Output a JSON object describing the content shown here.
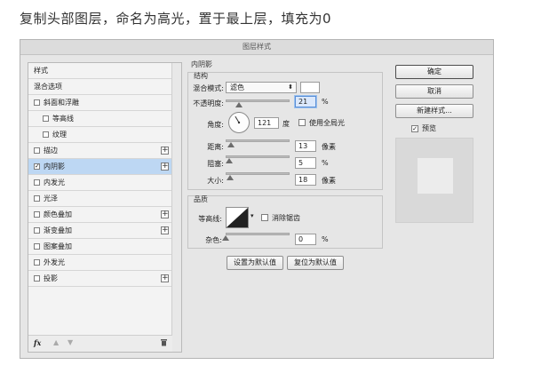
{
  "caption": "复制头部图层，命名为高光，置于最上层，填充为0",
  "dialog": {
    "title": "图层样式",
    "styles": [
      {
        "label": "样式",
        "checkbox": false,
        "checked": false,
        "indent": 0,
        "plus": false,
        "selected": false
      },
      {
        "label": "混合选项",
        "checkbox": false,
        "checked": false,
        "indent": 0,
        "plus": false,
        "selected": false
      },
      {
        "label": "斜面和浮雕",
        "checkbox": true,
        "checked": false,
        "indent": 0,
        "plus": false,
        "selected": false
      },
      {
        "label": "等高线",
        "checkbox": true,
        "checked": false,
        "indent": 1,
        "plus": false,
        "selected": false
      },
      {
        "label": "纹理",
        "checkbox": true,
        "checked": false,
        "indent": 1,
        "plus": false,
        "selected": false
      },
      {
        "label": "描边",
        "checkbox": true,
        "checked": false,
        "indent": 0,
        "plus": true,
        "selected": false
      },
      {
        "label": "内阴影",
        "checkbox": true,
        "checked": true,
        "indent": 0,
        "plus": true,
        "selected": true
      },
      {
        "label": "内发光",
        "checkbox": true,
        "checked": false,
        "indent": 0,
        "plus": false,
        "selected": false
      },
      {
        "label": "光泽",
        "checkbox": true,
        "checked": false,
        "indent": 0,
        "plus": false,
        "selected": false
      },
      {
        "label": "颜色叠加",
        "checkbox": true,
        "checked": false,
        "indent": 0,
        "plus": true,
        "selected": false
      },
      {
        "label": "渐变叠加",
        "checkbox": true,
        "checked": false,
        "indent": 0,
        "plus": true,
        "selected": false
      },
      {
        "label": "图案叠加",
        "checkbox": true,
        "checked": false,
        "indent": 0,
        "plus": false,
        "selected": false
      },
      {
        "label": "外发光",
        "checkbox": true,
        "checked": false,
        "indent": 0,
        "plus": false,
        "selected": false
      },
      {
        "label": "投影",
        "checkbox": true,
        "checked": false,
        "indent": 0,
        "plus": true,
        "selected": false
      }
    ],
    "footer_icons": [
      "fx-icon",
      "arrow-up-icon",
      "arrow-down-icon",
      "trash-icon"
    ],
    "footer_fx": "fx",
    "inner_shadow": {
      "title": "内阴影",
      "structure_title": "结构",
      "blend_mode_label": "混合模式:",
      "blend_mode_value": "滤色",
      "opacity_label": "不透明度:",
      "opacity_value": "21",
      "opacity_unit": "%",
      "opacity_fraction": 0.21,
      "angle_label": "角度:",
      "angle_value": "121",
      "angle_unit": "度",
      "global_light_label": "使用全局光",
      "distance_label": "距离:",
      "distance_value": "13",
      "distance_unit": "像素",
      "distance_fraction": 0.08,
      "choke_label": "阻塞:",
      "choke_value": "5",
      "choke_unit": "%",
      "choke_fraction": 0.05,
      "size_label": "大小:",
      "size_value": "18",
      "size_unit": "像素",
      "size_fraction": 0.07,
      "quality_title": "品质",
      "contour_label": "等高线:",
      "antialias_label": "消除锯齿",
      "noise_label": "杂色:",
      "noise_value": "0",
      "noise_unit": "%",
      "noise_fraction": 0.0,
      "set_default_label": "设置为默认值",
      "reset_default_label": "复位为默认值"
    },
    "buttons": {
      "ok": "确定",
      "cancel": "取消",
      "new_style": "新建样式...",
      "preview_label": "预览"
    }
  }
}
